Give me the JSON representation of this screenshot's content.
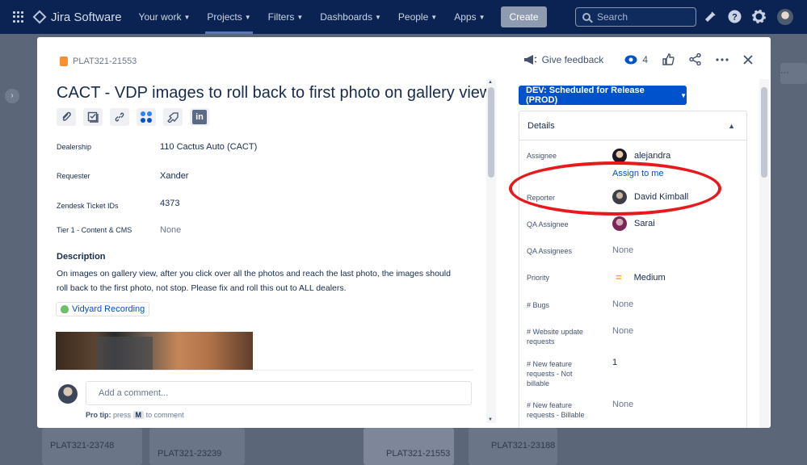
{
  "nav": {
    "logo": "Jira Software",
    "items": [
      {
        "label": "Your work",
        "chevron": true
      },
      {
        "label": "Projects",
        "chevron": true,
        "active": true
      },
      {
        "label": "Filters",
        "chevron": true
      },
      {
        "label": "Dashboards",
        "chevron": true
      },
      {
        "label": "People",
        "chevron": true
      },
      {
        "label": "Apps",
        "chevron": true
      }
    ],
    "create": "Create",
    "search_placeholder": "Search",
    "icons": [
      "notifications-icon",
      "help-icon",
      "settings-icon"
    ]
  },
  "background": {
    "cards": [
      "PLAT321-23748",
      "PLAT321-23239",
      "PLAT321-21553",
      "PLAT321-23188"
    ]
  },
  "issue": {
    "key": "PLAT321-21553",
    "title": "CACT - VDP images to roll back to first photo on gallery view",
    "fields": [
      {
        "label": "Dealership",
        "value": "110 Cactus Auto (CACT)",
        "muted": false
      },
      {
        "label": "Requester",
        "value": "Xander",
        "muted": false
      },
      {
        "label": "Zendesk Ticket IDs",
        "value": "4373",
        "muted": false
      },
      {
        "label": "Tier 1 - Content & CMS",
        "value": "None",
        "muted": true
      }
    ],
    "description_heading": "Description",
    "description": "On images on gallery view, after you click over all the photos and reach the last photo, the images should roll back to the first photo, not stop. Please fix and roll this out to ALL dealers.",
    "attachment_link": "Vidyard Recording",
    "comment_placeholder": "Add a comment...",
    "protip": {
      "prefix": "Pro tip:",
      "mid": "press",
      "key": "M",
      "suffix": "to comment"
    }
  },
  "header": {
    "feedback": "Give feedback",
    "watch_count": "4"
  },
  "status": "DEV: Scheduled for Release (PROD)",
  "details": {
    "heading": "Details",
    "assignee_label": "Assignee",
    "assignee": "alejandra",
    "assign_to_me": "Assign to me",
    "reporter_label": "Reporter",
    "reporter": "David Kimball",
    "qa_assignee_label": "QA Assignee",
    "qa_assignee": "Sarai",
    "qa_assignees_label": "QA Assignees",
    "qa_assignees": "None",
    "priority_label": "Priority",
    "priority": "Medium",
    "bugs_label": "# Bugs",
    "bugs": "None",
    "website_update_label": "# Website update requests",
    "website_update": "None",
    "nfr_nonbillable_label": "# New feature requests - Not billable",
    "nfr_nonbillable": "1",
    "nfr_billable_label": "# New feature requests - Billable",
    "nfr_billable": "None"
  },
  "colors": {
    "accent": "#0052cc",
    "nav": "#0b2352",
    "annotation": "#e8191c",
    "priority_medium": "#ffab00"
  }
}
